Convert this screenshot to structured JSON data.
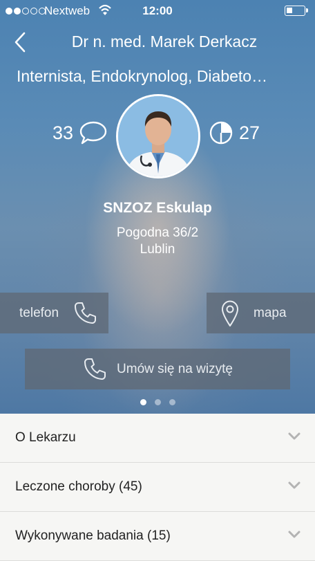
{
  "status_bar": {
    "carrier": "Nextweb",
    "time": "12:00"
  },
  "header": {
    "title": "Dr n. med. Marek Derkacz",
    "specialties": "Internista, Endokrynolog, Diabeto…"
  },
  "stats": {
    "comments": "33",
    "rating": "27"
  },
  "clinic": {
    "name": "SNZOZ Eskulap",
    "street": "Pogodna 36/2",
    "city": "Lublin"
  },
  "actions": {
    "phone_label": "telefon",
    "map_label": "mapa",
    "visit_label": "Umów się na wizytę"
  },
  "pager": {
    "pages": 3,
    "active": 0
  },
  "sections": [
    {
      "label": "O Lekarzu"
    },
    {
      "label": "Leczone choroby (45)"
    },
    {
      "label": "Wykonywane badania (15)"
    }
  ],
  "colors": {
    "accent": "#ffffff",
    "button_bg": "#5f6976",
    "list_bg": "#f6f6f4",
    "chevron": "#b3b3b3"
  }
}
